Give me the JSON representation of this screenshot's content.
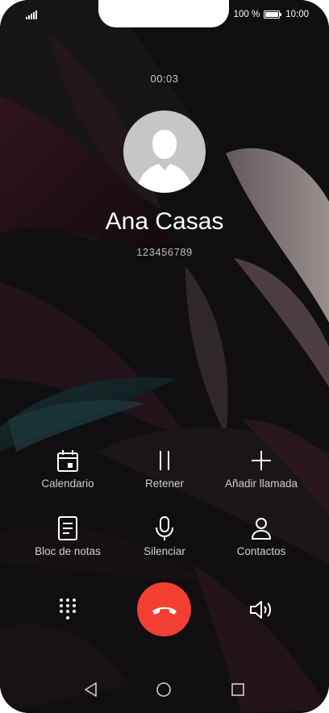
{
  "status_bar": {
    "battery_percent": "100 %",
    "time": "10:00",
    "icons": [
      "signal-icon",
      "battery-icon"
    ]
  },
  "call": {
    "duration": "00:03",
    "contact_name": "Ana Casas",
    "phone_number": "123456789"
  },
  "actions": [
    {
      "label": "Calendario",
      "icon": "calendar-icon"
    },
    {
      "label": "Retener",
      "icon": "pause-icon"
    },
    {
      "label": "Añadir llamada",
      "icon": "plus-icon"
    },
    {
      "label": "Bloc de notas",
      "icon": "notepad-icon"
    },
    {
      "label": "Silenciar",
      "icon": "microphone-icon"
    },
    {
      "label": "Contactos",
      "icon": "contacts-icon"
    }
  ],
  "bottom_controls": [
    "dialpad-icon",
    "end-call-icon",
    "speaker-icon"
  ],
  "nav_bar": [
    "back-icon",
    "home-icon",
    "recents-icon"
  ],
  "colors": {
    "end_call": "#f23f32",
    "background": "#0c0b0d",
    "text": "#ffffff",
    "subtext": "#cfcfcf"
  }
}
